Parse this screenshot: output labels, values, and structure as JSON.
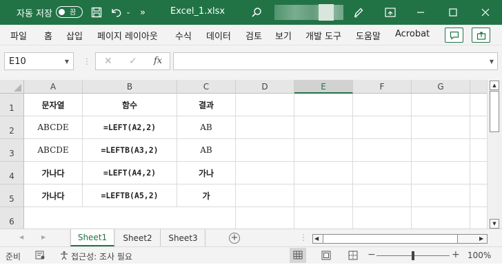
{
  "titlebar": {
    "autosave_label": "자동 저장",
    "autosave_state": "끔",
    "more": "»",
    "filename": "Excel_1.xlsx",
    "accent": "#217346"
  },
  "ribbon": {
    "tabs": [
      "파일",
      "홈",
      "삽입",
      "페이지 레이아웃",
      "수식",
      "데이터",
      "검토",
      "보기",
      "개발 도구",
      "도움말",
      "Acrobat"
    ]
  },
  "formula_bar": {
    "name_box": "E10",
    "fx": "fx",
    "value": ""
  },
  "grid": {
    "columns": [
      "A",
      "B",
      "C",
      "D",
      "E",
      "F",
      "G"
    ],
    "selected_column": "E",
    "rows": [
      "1",
      "2",
      "3",
      "4",
      "5",
      "6"
    ],
    "cells": [
      [
        "문자열",
        "함수",
        "결과"
      ],
      [
        "ABCDE",
        "=LEFT(A2,2)",
        "AB"
      ],
      [
        "ABCDE",
        "=LEFTB(A3,2)",
        "AB"
      ],
      [
        "가나다",
        "=LEFT(A4,2)",
        "가나"
      ],
      [
        "가나다",
        "=LEFTB(A5,2)",
        "가"
      ]
    ]
  },
  "sheets": {
    "tabs": [
      "Sheet1",
      "Sheet2",
      "Sheet3"
    ],
    "active": "Sheet1"
  },
  "statusbar": {
    "ready": "준비",
    "accessibility": "접근성: 조사 필요",
    "zoom": "100%",
    "zoom_level": 1.0
  }
}
